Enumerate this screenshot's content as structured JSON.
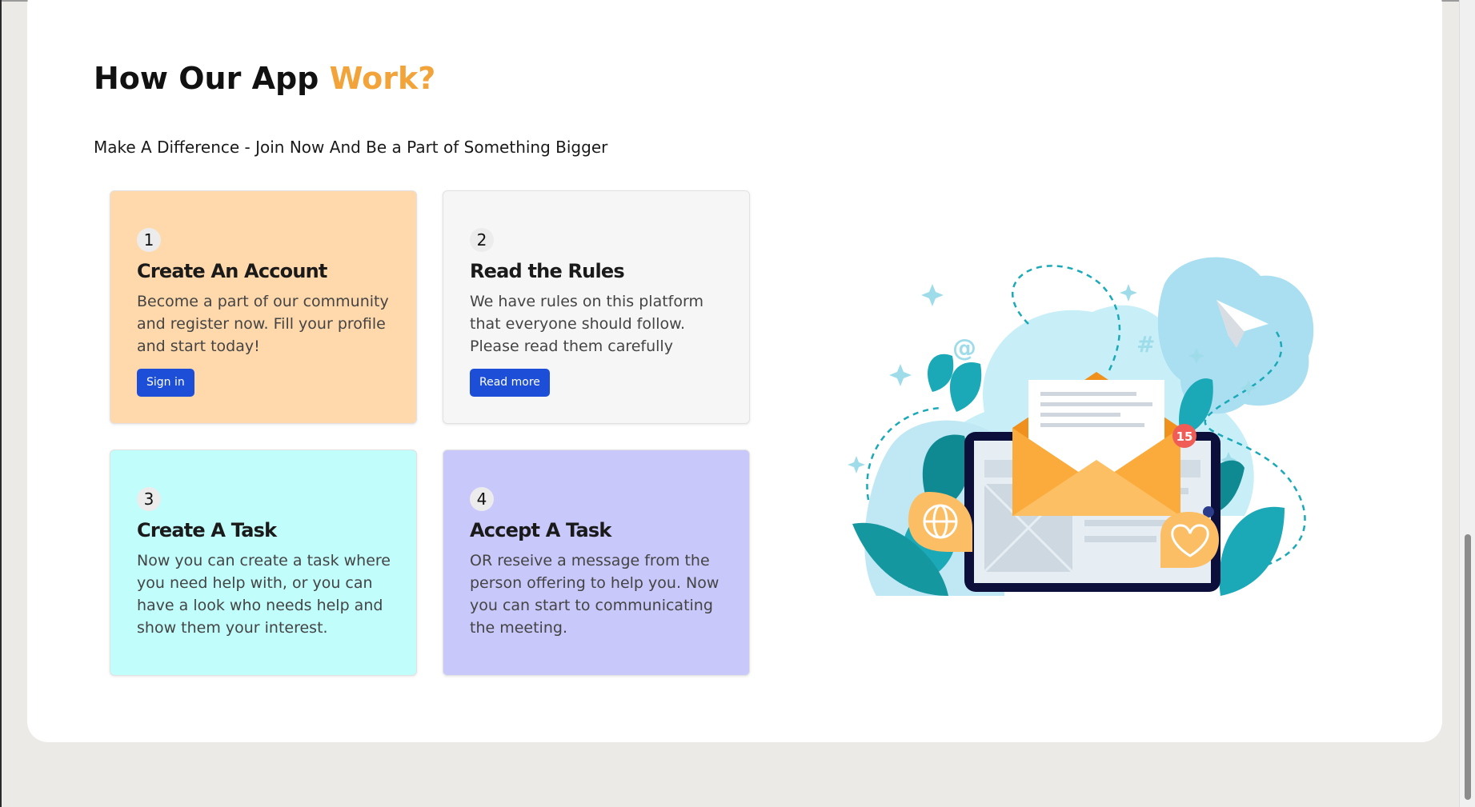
{
  "section": {
    "title_main": "How Our App ",
    "title_accent": "Work?",
    "subtitle": "Make A Difference - Join Now And Be a Part of Something Bigger"
  },
  "cards": [
    {
      "number": "1",
      "title": "Create An Account",
      "text": "Become a part of our community and register now. Fill your profile and start today!",
      "button": "Sign in",
      "background": "#ffd9ab"
    },
    {
      "number": "2",
      "title": "Read the Rules",
      "text": "We have rules on this platform that everyone should follow. Please read them carefully",
      "button": "Read more",
      "background": "#f6f6f6"
    },
    {
      "number": "3",
      "title": "Create A Task",
      "text": "Now you can create a task where you need help with, or you can have a look who needs help and show them your interest.",
      "background": "#c1fdfb"
    },
    {
      "number": "4",
      "title": "Accept A Task",
      "text": "OR reseive a message from the person offering to help you. Now you can start to communicating the meeting.",
      "background": "#c8c8fa"
    }
  ],
  "illustration": {
    "badge_count": "15",
    "icons": [
      "paper-plane-icon",
      "envelope-icon",
      "globe-icon",
      "heart-icon",
      "at-sign-icon",
      "hashtag-icon"
    ]
  },
  "colors": {
    "accent": "#f2a33a",
    "button": "#1d4ed8",
    "teal": "#1ba9b8",
    "light_blue": "#b9e9f4"
  }
}
